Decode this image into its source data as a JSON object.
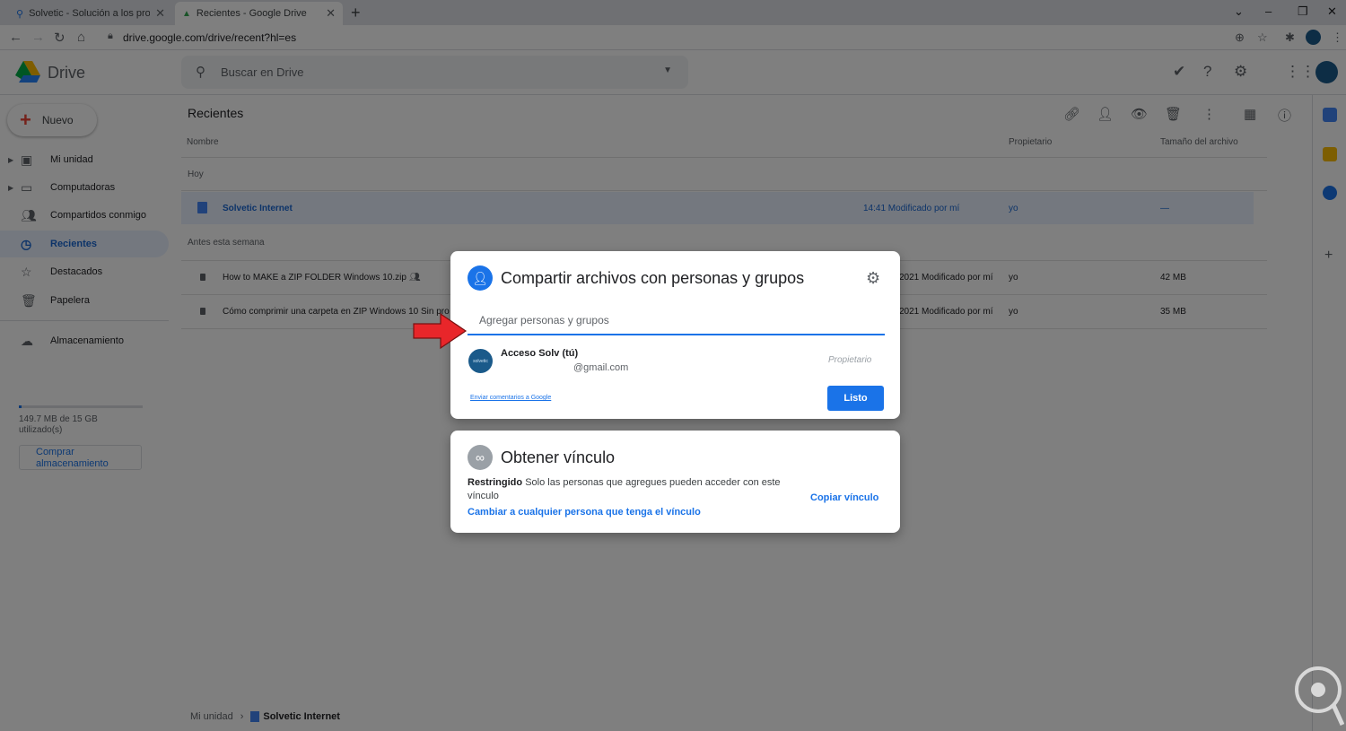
{
  "browser": {
    "tabs": [
      {
        "title": "Solvetic - Solución a los problemas",
        "active": false
      },
      {
        "title": "Recientes - Google Drive",
        "active": true
      }
    ],
    "new_tab_icon": "plus-icon",
    "url": "drive.google.com/drive/recent?hl=es"
  },
  "drive": {
    "logo_text": "Drive",
    "search_placeholder": "Buscar en Drive",
    "new_button": "Nuevo",
    "nav": [
      {
        "label": "Mi unidad",
        "icon": "drive-icon",
        "active": false
      },
      {
        "label": "Computadoras",
        "icon": "computer-icon",
        "active": false
      },
      {
        "label": "Compartidos conmigo",
        "icon": "people-icon",
        "active": false
      },
      {
        "label": "Recientes",
        "icon": "clock-icon",
        "active": true
      },
      {
        "label": "Destacados",
        "icon": "star-icon",
        "active": false
      },
      {
        "label": "Papelera",
        "icon": "trash-icon",
        "active": false
      }
    ],
    "storage": {
      "label": "Almacenamiento",
      "usage_text": "149.7 MB de 15 GB utilizado(s)",
      "fraction_used": 0.01,
      "buy_button": "Comprar almacenamiento"
    },
    "main_title": "Recientes",
    "columns": {
      "name": "Nombre",
      "owner": "Propietario",
      "size": "Tamaño del archivo"
    },
    "groups": {
      "today": "Hoy",
      "earlier": "Antes esta semana"
    },
    "files_today": [
      {
        "name": "Solvetic Internet",
        "modified": "14:41 Modificado por mí",
        "owner": "yo",
        "size": "—"
      }
    ],
    "files_earlier": [
      {
        "name": "How to MAKE a ZIP FOLDER Windows 10.zip",
        "modified": "2021 Modificado por mí",
        "owner": "yo",
        "size": "42 MB"
      },
      {
        "name": "Cómo comprimir una carpeta en ZIP Windows 10 Sin pro",
        "modified": "2021 Modificado por mí",
        "owner": "yo",
        "size": "35 MB"
      }
    ],
    "breadcrumb": {
      "root": "Mi unidad",
      "current": "Solvetic Internet"
    }
  },
  "share_dialog": {
    "title": "Compartir archivos con personas y grupos",
    "input_placeholder": "Agregar personas y grupos",
    "person": {
      "name": "Acceso Solv (tú)",
      "email": "@gmail.com",
      "role": "Propietario",
      "avatar_text": "solvetic"
    },
    "feedback_link": "Enviar comentarios a Google",
    "done_button": "Listo"
  },
  "link_dialog": {
    "title": "Obtener vínculo",
    "restriction": "Restringido",
    "description": "Solo las personas que agregues pueden acceder con este vínculo",
    "change_link": "Cambiar a cualquier persona que tenga el vínculo",
    "copy_button": "Copiar vínculo"
  },
  "colors": {
    "accent": "#1a73e8",
    "overlay": "rgba(0,0,0,0.5)",
    "arrow": "#e8262a"
  }
}
